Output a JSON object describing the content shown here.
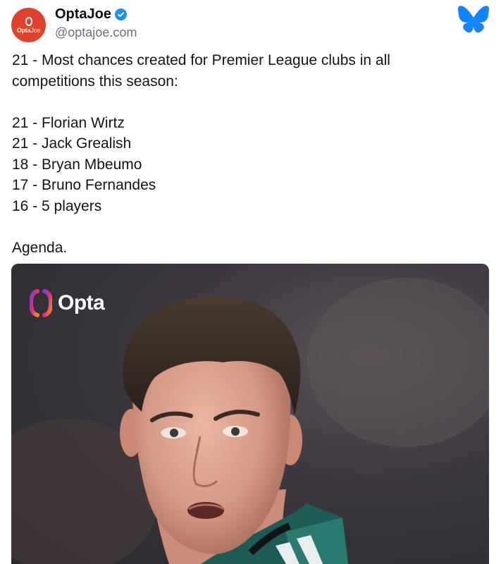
{
  "post": {
    "author": {
      "display_name": "OptaJoe",
      "handle": "@optajoe.com",
      "avatar_text_bold": "Opta",
      "avatar_text_light": "Joe",
      "verified_icon": "verified-check-icon"
    },
    "platform_icon": "bluesky-butterfly-icon",
    "text": {
      "intro_line1": "21 - Most chances created for Premier League clubs in all",
      "intro_line2": "competitions this season:",
      "list": [
        "21 - Florian Wirtz",
        "21 - Jack Grealish",
        "18 - Bryan Mbeumo",
        "17 - Bruno Fernandes",
        "16 - 5 players"
      ],
      "closing": "Agenda."
    },
    "media": {
      "brand_word": "Opta",
      "photo": "player-portrait"
    }
  },
  "colors": {
    "accent_blue": "#1d8ff0",
    "bluesky_blue": "#1185fe",
    "avatar_red": "#e0412a",
    "handle_gray": "#66727f"
  }
}
